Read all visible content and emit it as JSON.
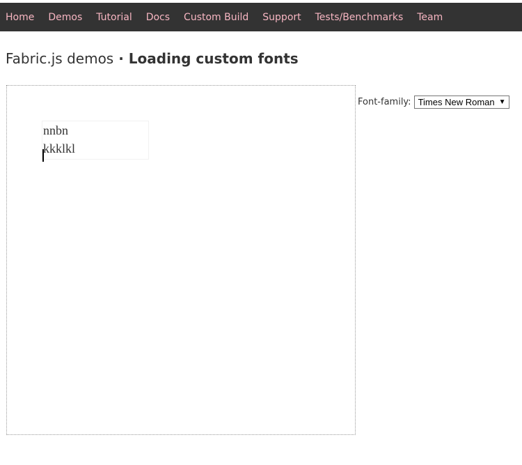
{
  "nav": {
    "items": [
      {
        "label": "Home"
      },
      {
        "label": "Demos"
      },
      {
        "label": "Tutorial"
      },
      {
        "label": "Docs"
      },
      {
        "label": "Custom Build"
      },
      {
        "label": "Support"
      },
      {
        "label": "Tests/Benchmarks"
      },
      {
        "label": "Team"
      }
    ]
  },
  "heading": {
    "prefix": "Fabric.js demos",
    "separator": " · ",
    "title": "Loading custom fonts"
  },
  "canvas": {
    "text_lines": [
      "nnbn",
      "kkklkl"
    ]
  },
  "font_control": {
    "label": "Font-family:",
    "selected": "Times New Roman",
    "arrow": "▼"
  },
  "colors": {
    "navbar_bg": "#333333",
    "nav_link": "#f7b6c2",
    "heading_text": "#333333"
  }
}
